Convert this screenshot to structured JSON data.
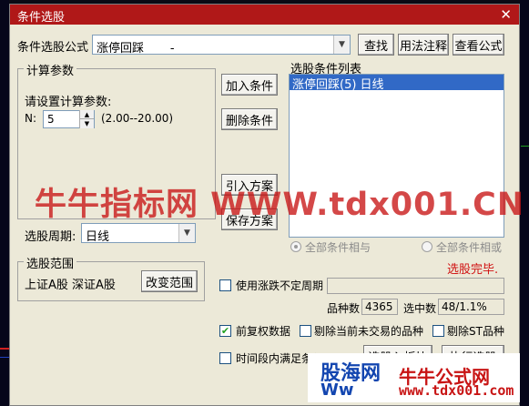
{
  "window": {
    "title": "条件选股",
    "close": "✕"
  },
  "formula": {
    "label": "条件选股公式",
    "value": "涨停回踩       -",
    "find_button": "查找",
    "usage_button": "用法注释",
    "view_button": "查看公式"
  },
  "params": {
    "group_label": "计算参数",
    "prompt": "请设置计算参数:",
    "n_label": "N:",
    "n_value": "5",
    "range": "(2.00--20.00)"
  },
  "actions": {
    "add": "加入条件",
    "delete": "删除条件",
    "import": "引入方案",
    "save": "保存方案"
  },
  "condition_list": {
    "label": "选股条件列表",
    "items": [
      "涨停回踩(5) 日线"
    ]
  },
  "period": {
    "label": "选股周期:",
    "value": "日线"
  },
  "logic": {
    "and_label": "全部条件相与",
    "or_label": "全部条件相或",
    "status": "选股完毕.",
    "status_color": "#d01010"
  },
  "scope": {
    "group_label": "选股范围",
    "value": "上证A股 深证A股",
    "change_button": "改变范围"
  },
  "options": {
    "variable_period": "使用涨跌不定周期",
    "fq_label": "前复权数据",
    "exclude_untraded": "剔除当前未交易的品种",
    "exclude_st": "剔除ST品种",
    "time_range": "时间段内满足条件"
  },
  "stats": {
    "count_label": "品种数",
    "count_value": "4365",
    "selected_label": "选中数",
    "selected_value": "48/1.1%"
  },
  "bottom": {
    "to_block": "选股入板块",
    "execute": "执行选股"
  },
  "watermark": "牛牛指标网 WWW.tdx001.CN",
  "logo": {
    "text1": "股海网",
    "text2": "牛牛公式网",
    "url": "www.tdx001.com",
    "text4": "Ww"
  },
  "colors": {
    "titlebar": "#b01818",
    "selection": "#3169c6",
    "dialog_bg": "#ece9d8"
  }
}
